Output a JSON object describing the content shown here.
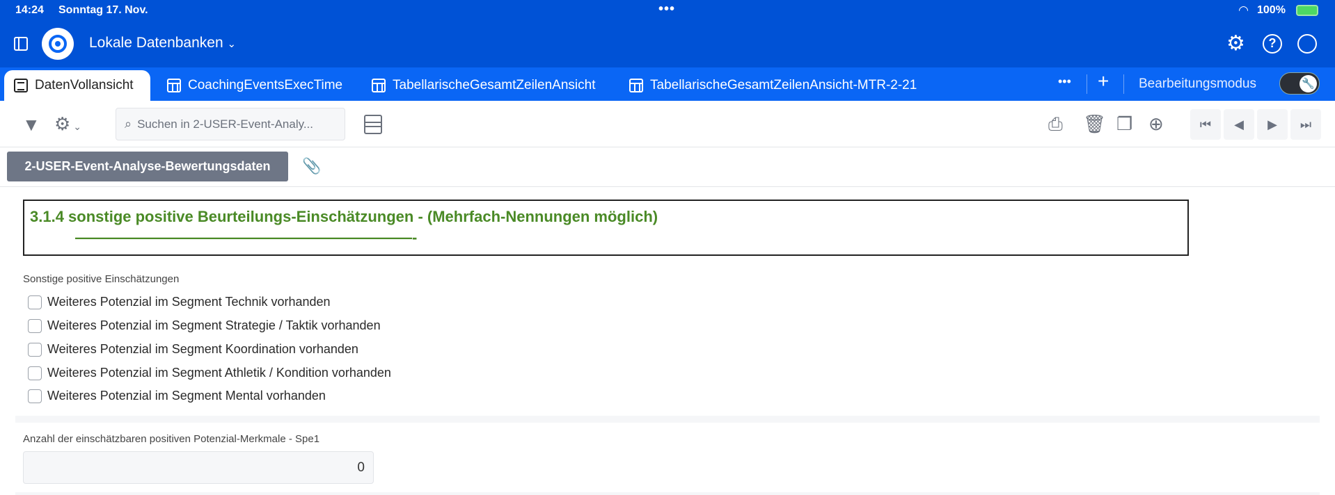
{
  "status": {
    "time": "14:24",
    "date": "Sonntag 17. Nov.",
    "battery": "100%"
  },
  "header": {
    "title": "Lokale Datenbanken"
  },
  "tabs": [
    {
      "label": "DatenVollansicht"
    },
    {
      "label": "CoachingEventsExecTime"
    },
    {
      "label": "TabellarischeGesamtZeilenAnsicht"
    },
    {
      "label": "TabellarischeGesamtZeilenAnsicht-MTR-2-21"
    }
  ],
  "edit_mode": {
    "label": "Bearbeitungsmodus",
    "on": true
  },
  "search": {
    "placeholder": "Suchen in 2-USER-Event-Analy..."
  },
  "record_tab": "2-USER-Event-Analyse-Bewertungsdaten",
  "section": {
    "title": "3.1.4  sonstige positive Beurteilungs-Einschätzungen - (Mehrfach-Nennungen möglich)",
    "underline": "——————————————————————-"
  },
  "group_label": "Sonstige positive Einschätzungen",
  "checkboxes": [
    {
      "label": "Weiteres Potenzial im Segment Technik vorhanden",
      "checked": false
    },
    {
      "label": "Weiteres Potenzial im Segment Strategie / Taktik vorhanden",
      "checked": false
    },
    {
      "label": "Weiteres Potenzial im Segment Koordination vorhanden",
      "checked": false
    },
    {
      "label": "Weiteres Potenzial im Segment Athletik / Kondition vorhanden",
      "checked": false
    },
    {
      "label": "Weiteres Potenzial im Segment Mental vorhanden",
      "checked": false
    }
  ],
  "count_field": {
    "label": "Anzahl der einschätzbaren positiven Potenzial-Merkmale - Spe1",
    "value": "0"
  }
}
